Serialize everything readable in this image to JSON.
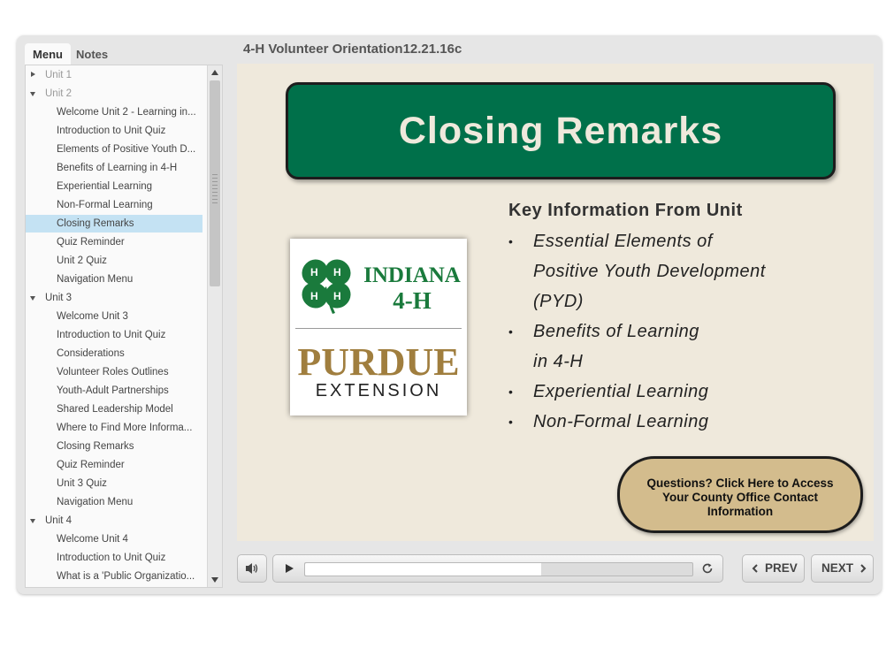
{
  "course_title": "4-H Volunteer Orientation12.21.16c",
  "sidebar": {
    "tabs": [
      {
        "label": "Menu",
        "active": true
      },
      {
        "label": "Notes",
        "active": false
      }
    ],
    "items": [
      {
        "label": "Unit 1",
        "level": 0,
        "expanded": false,
        "dimmed": true
      },
      {
        "label": "Unit 2",
        "level": 0,
        "expanded": true,
        "dimmed": true
      },
      {
        "label": "Welcome Unit 2 - Learning in...",
        "level": 1
      },
      {
        "label": "Introduction to Unit Quiz",
        "level": 1
      },
      {
        "label": "Elements of Positive Youth D...",
        "level": 1
      },
      {
        "label": "Benefits of Learning in 4-H",
        "level": 1
      },
      {
        "label": "Experiential Learning",
        "level": 1
      },
      {
        "label": "Non-Formal Learning",
        "level": 1
      },
      {
        "label": "Closing Remarks",
        "level": 1,
        "selected": true
      },
      {
        "label": "Quiz Reminder",
        "level": 1
      },
      {
        "label": "Unit 2 Quiz",
        "level": 1
      },
      {
        "label": "Navigation Menu",
        "level": 1
      },
      {
        "label": "Unit 3",
        "level": 0,
        "expanded": true
      },
      {
        "label": "Welcome Unit 3",
        "level": 1
      },
      {
        "label": "Introduction to Unit Quiz",
        "level": 1
      },
      {
        "label": "Considerations",
        "level": 1
      },
      {
        "label": "Volunteer Roles Outlines",
        "level": 1
      },
      {
        "label": "Youth-Adult Partnerships",
        "level": 1
      },
      {
        "label": "Shared Leadership Model",
        "level": 1
      },
      {
        "label": "Where to Find More Informa...",
        "level": 1
      },
      {
        "label": "Closing Remarks",
        "level": 1
      },
      {
        "label": "Quiz Reminder",
        "level": 1
      },
      {
        "label": "Unit 3 Quiz",
        "level": 1
      },
      {
        "label": "Navigation Menu",
        "level": 1
      },
      {
        "label": "Unit 4",
        "level": 0,
        "expanded": true
      },
      {
        "label": "Welcome Unit 4",
        "level": 1
      },
      {
        "label": "Introduction to Unit Quiz",
        "level": 1
      },
      {
        "label": "What is a 'Public Organizatio...",
        "level": 1
      }
    ]
  },
  "slide": {
    "banner_title": "Closing Remarks",
    "logo": {
      "line1": "INDIANA",
      "line2": "4-H",
      "brand": "PURDUE",
      "subbrand": "EXTENSION",
      "clover_letter": "H"
    },
    "key_heading": "Key Information From Unit",
    "bullets": [
      [
        "Essential Elements of",
        "Positive Youth Development",
        "(PYD)"
      ],
      [
        "Benefits of Learning",
        "in 4-H"
      ],
      [
        "Experiential Learning"
      ],
      [
        "Non-Formal Learning"
      ]
    ],
    "bullet_char": "•",
    "questions_button": "Questions? Click Here to Access Your County Office Contact Information"
  },
  "controls": {
    "prev_label": "PREV",
    "next_label": "NEXT",
    "progress_fraction": 0.61
  },
  "colors": {
    "banner_green": "#00704a",
    "slide_bg": "#efe9dc",
    "button_tan": "#d3bc8d",
    "selected_item": "#c4e2f3",
    "purdue_gold": "#a07e3e"
  }
}
